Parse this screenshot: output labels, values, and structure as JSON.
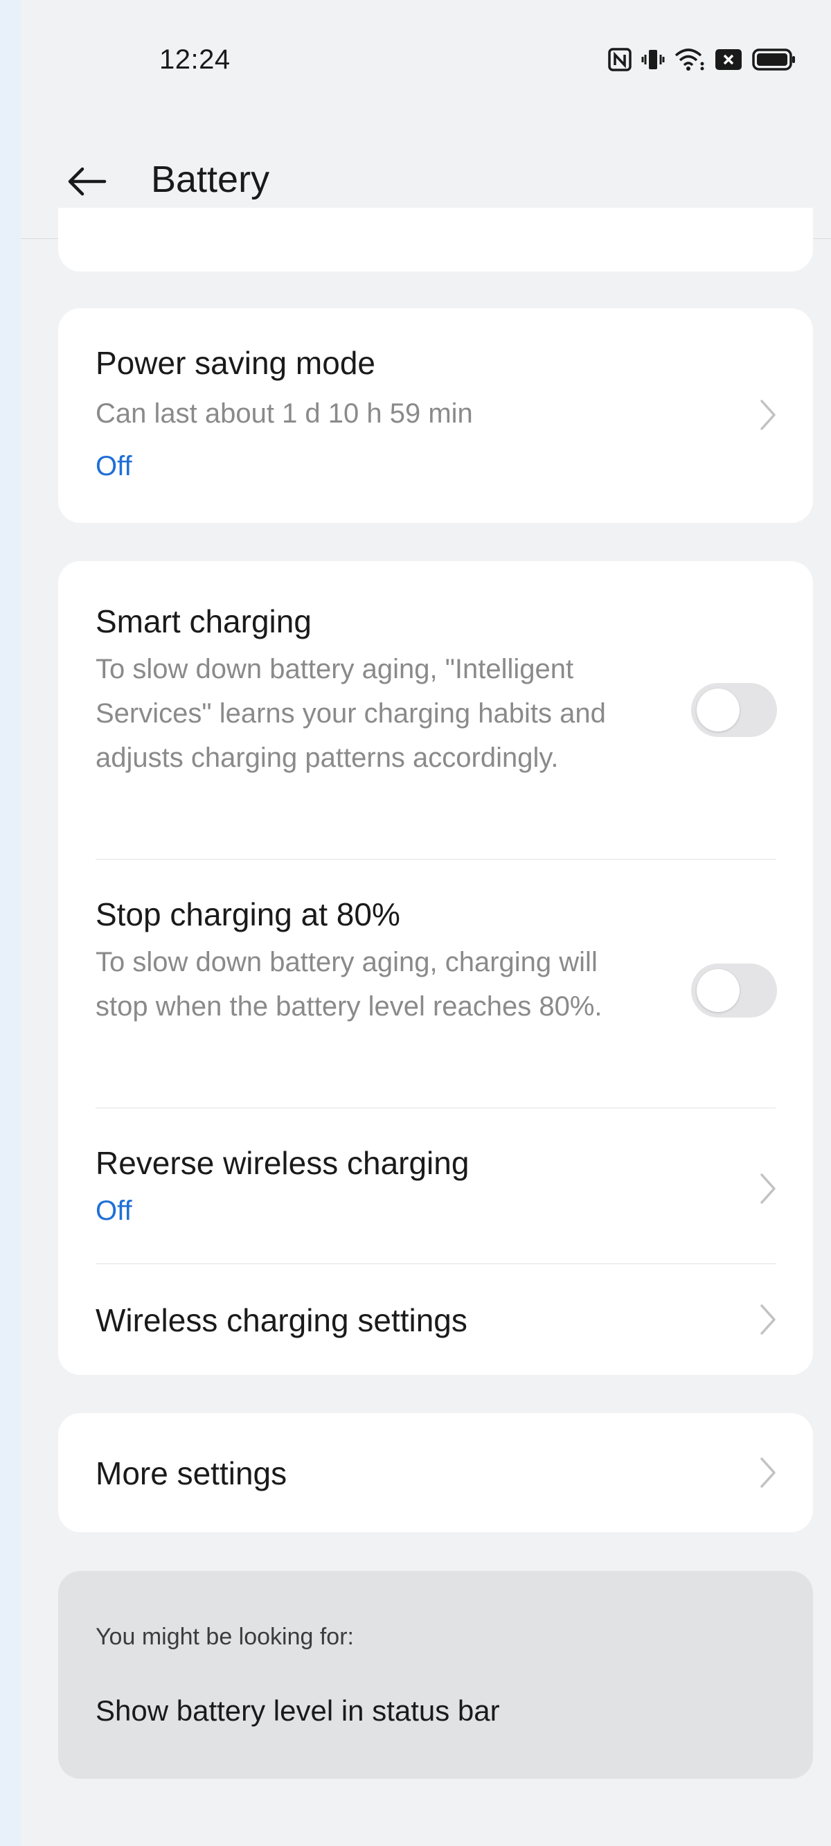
{
  "status_bar": {
    "time": "12:24",
    "icons": [
      "nfc-icon",
      "vibrate-icon",
      "wifi-icon",
      "notification-icon",
      "battery-icon"
    ]
  },
  "app_bar": {
    "back_icon": "arrow-left-icon",
    "title": "Battery"
  },
  "power_saving": {
    "title": "Power saving mode",
    "subtitle": "Can last about 1 d 10 h 59 min",
    "state": "Off"
  },
  "charging": {
    "smart_charging": {
      "title": "Smart charging",
      "description": "To slow down battery aging, \"Intelligent Services\" learns your charging habits and adjusts charging patterns accordingly.",
      "enabled": false
    },
    "stop_at_80": {
      "title": "Stop charging at 80%",
      "description": "To slow down battery aging, charging will stop when the battery level reaches 80%.",
      "enabled": false
    },
    "reverse_wireless": {
      "title": "Reverse wireless charging",
      "state": "Off"
    },
    "wireless_settings": {
      "title": "Wireless charging settings"
    }
  },
  "more": {
    "title": "More settings"
  },
  "suggestions": {
    "heading": "You might be looking for:",
    "item": "Show battery level in status bar"
  },
  "colors": {
    "accent": "#1f6fd6",
    "background": "#f1f2f4",
    "card": "#ffffff"
  }
}
